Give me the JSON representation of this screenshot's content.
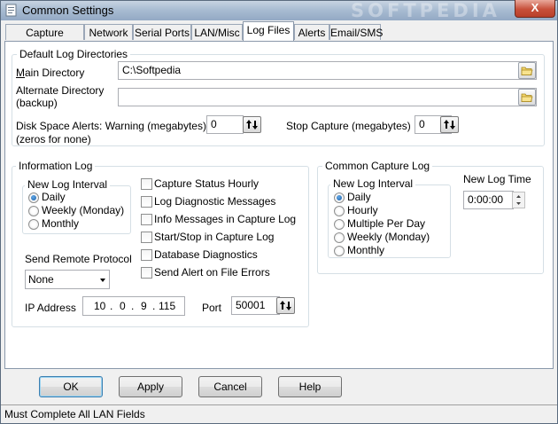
{
  "window": {
    "title": "Common Settings",
    "close_symbol": "X",
    "watermark": "SOFTPEDIA"
  },
  "tabs": [
    {
      "label": "Capture Logging"
    },
    {
      "label": "Network"
    },
    {
      "label": "Serial Ports"
    },
    {
      "label": "LAN/Misc"
    },
    {
      "label": "Log Files",
      "active": true
    },
    {
      "label": "Alerts"
    },
    {
      "label": "Email/SMS"
    }
  ],
  "default_log_dirs": {
    "legend": "Default Log Directories",
    "main_label": "Main Directory",
    "main_value": "C:\\Softpedia",
    "alt_label_1": "Alternate Directory",
    "alt_label_2": "(backup)",
    "alt_value": "",
    "disk_label_1": "Disk Space Alerts: Warning (megabytes)",
    "disk_label_2": "(zeros for none)",
    "disk_value": "0",
    "stop_label": "Stop Capture (megabytes)",
    "stop_value": "0"
  },
  "info_log": {
    "legend": "Information Log",
    "interval_legend": "New Log Interval",
    "intervals": [
      "Daily",
      "Weekly (Monday)",
      "Monthly"
    ],
    "selected_interval": "Daily",
    "checkboxes": [
      "Capture Status Hourly",
      "Log Diagnostic Messages",
      "Info Messages in Capture Log",
      "Start/Stop in Capture Log",
      "Database Diagnostics",
      "Send Alert on File Errors"
    ],
    "remote_label": "Send Remote Protocol",
    "remote_value": "None",
    "ip_label": "IP Address",
    "ip_octets": [
      "10",
      "0",
      "9",
      "115"
    ],
    "port_label": "Port",
    "port_value": "50001"
  },
  "capture_log": {
    "legend": "Common Capture Log",
    "interval_legend": "New Log Interval",
    "intervals": [
      "Daily",
      "Hourly",
      "Multiple Per Day",
      "Weekly (Monday)",
      "Monthly"
    ],
    "selected_interval": "Daily",
    "time_label": "New Log Time",
    "time_value": "0:00:00"
  },
  "buttons": {
    "ok": "OK",
    "apply": "Apply",
    "cancel": "Cancel",
    "help": "Help"
  },
  "status": {
    "text": "Must Complete All LAN Fields"
  }
}
